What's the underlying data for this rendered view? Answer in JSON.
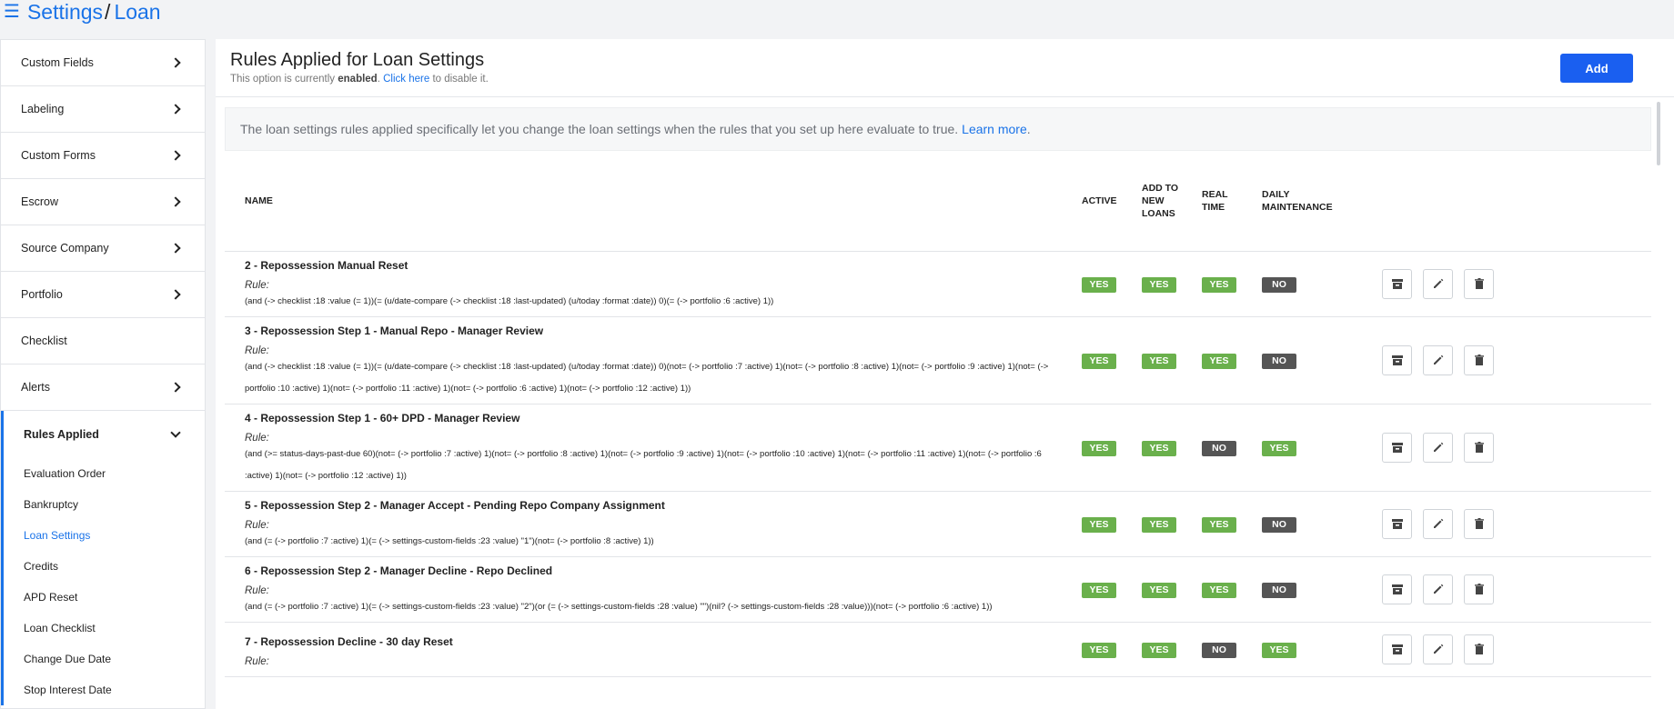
{
  "header": {
    "crumbs": [
      "Settings",
      "Loan"
    ],
    "separator": "/"
  },
  "sidebar": {
    "items": [
      {
        "label": "Custom Fields"
      },
      {
        "label": "Labeling"
      },
      {
        "label": "Custom Forms"
      },
      {
        "label": "Escrow"
      },
      {
        "label": "Source Company"
      },
      {
        "label": "Portfolio"
      },
      {
        "label": "Checklist"
      },
      {
        "label": "Alerts"
      }
    ],
    "group": {
      "label": "Rules Applied",
      "sub": [
        "Evaluation Order",
        "Bankruptcy",
        "Loan Settings",
        "Credits",
        "APD Reset",
        "Loan Checklist",
        "Change Due Date",
        "Stop Interest Date"
      ],
      "active": "Loan Settings"
    }
  },
  "main": {
    "title": "Rules Applied for Loan Settings",
    "sub_prefix": "This option is currently ",
    "sub_state": "enabled",
    "sub_mid": ". ",
    "sub_link": "Click here",
    "sub_suffix": " to disable it.",
    "add_label": "Add",
    "info_text": "The loan settings rules applied specifically let you change the loan settings when the rules that you set up here evaluate to true.",
    "info_link": "Learn more",
    "info_end": "."
  },
  "table": {
    "headers": {
      "name": "NAME",
      "active": "ACTIVE",
      "add_new": "ADD TO NEW LOANS",
      "real_time": "REAL TIME",
      "daily": "DAILY MAINTENANCE"
    },
    "rule_label": "Rule:",
    "rows": [
      {
        "name": "2 - Repossession Manual Reset",
        "expr": "(and (-> checklist :18 :value (= 1))(= (u/date-compare (-> checklist :18 :last-updated) (u/today :format :date)) 0)(= (-> portfolio :6 :active) 1))",
        "active": "YES",
        "add_new": "YES",
        "real_time": "YES",
        "daily": "NO"
      },
      {
        "name": "3 - Repossession Step 1 - Manual Repo - Manager Review",
        "expr": "(and (-> checklist :18 :value (= 1))(= (u/date-compare (-> checklist :18 :last-updated) (u/today :format :date)) 0)(not= (-> portfolio :7 :active) 1)(not= (-> portfolio :8 :active) 1)(not= (-> portfolio :9 :active) 1)(not= (-> portfolio :10 :active) 1)(not= (-> portfolio :11 :active) 1)(not= (-> portfolio :6 :active) 1)(not= (-> portfolio :12 :active) 1))",
        "active": "YES",
        "add_new": "YES",
        "real_time": "YES",
        "daily": "NO"
      },
      {
        "name": "4 - Repossession Step 1 - 60+ DPD - Manager Review",
        "expr": "(and (>= status-days-past-due 60)(not= (-> portfolio :7 :active) 1)(not= (-> portfolio :8 :active) 1)(not= (-> portfolio :9 :active) 1)(not= (-> portfolio :10 :active) 1)(not= (-> portfolio :11 :active) 1)(not= (-> portfolio :6 :active) 1)(not= (-> portfolio :12 :active) 1))",
        "active": "YES",
        "add_new": "YES",
        "real_time": "NO",
        "daily": "YES"
      },
      {
        "name": "5 - Repossession Step 2 - Manager Accept - Pending Repo Company Assignment",
        "expr": "(and (= (-> portfolio :7 :active) 1)(= (-> settings-custom-fields :23 :value) \"1\")(not= (-> portfolio :8 :active) 1))",
        "active": "YES",
        "add_new": "YES",
        "real_time": "YES",
        "daily": "NO"
      },
      {
        "name": "6 - Repossession Step 2 - Manager Decline - Repo Declined",
        "expr": "(and (= (-> portfolio :7 :active) 1)(= (-> settings-custom-fields :23 :value) \"2\")(or (= (-> settings-custom-fields :28 :value) \"\")(nil? (-> settings-custom-fields :28 :value)))(not= (-> portfolio :6 :active) 1))",
        "active": "YES",
        "add_new": "YES",
        "real_time": "YES",
        "daily": "NO"
      },
      {
        "name": "7 - Repossession Decline - 30 day Reset",
        "expr": "",
        "active": "YES",
        "add_new": "YES",
        "real_time": "NO",
        "daily": "YES"
      }
    ]
  },
  "icons": {
    "menu": "hamburger-icon",
    "archive": "archive-icon",
    "edit": "pencil-icon",
    "delete": "trash-icon",
    "chevron": "chevron-right-icon"
  },
  "colors": {
    "accent": "#1a73e8",
    "yes": "#6ab04c",
    "no": "#555555",
    "add_button": "#1a5ff0"
  }
}
